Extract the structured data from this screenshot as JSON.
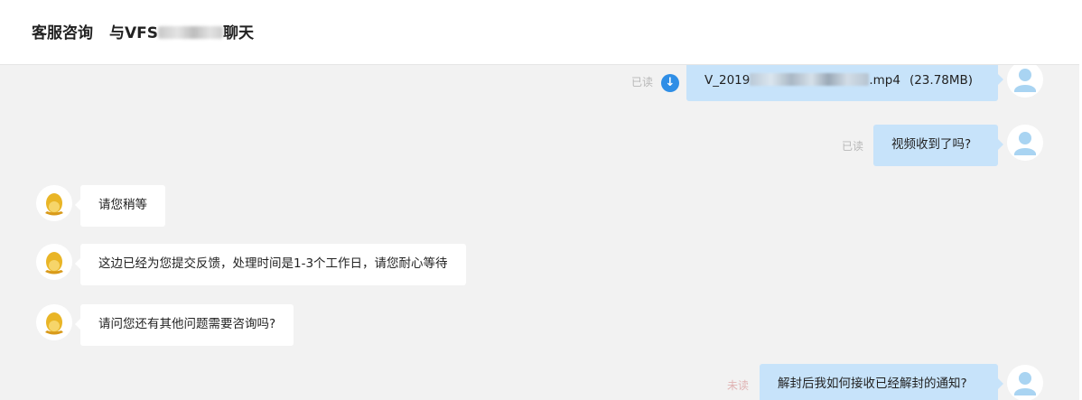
{
  "header": {
    "title_main": "客服咨询",
    "title_prefix": "与VFS",
    "title_suffix": "聊天"
  },
  "icons": {
    "agent_avatar": "penguin-avatar-icon",
    "user_avatar": "default-user-avatar-icon",
    "download": "download-arrow-icon"
  },
  "colors": {
    "user_bubble": "#c7e3fa",
    "agent_bubble": "#ffffff",
    "download_icon": "#2f8ee6",
    "status_read": "#b8b8b8",
    "status_unread": "#e0b4b4"
  },
  "messages": [
    {
      "side": "right",
      "status": "已读",
      "type": "file",
      "file_prefix": "V_2019",
      "file_ext": ".mp4",
      "file_size": "(23.78MB)"
    },
    {
      "side": "right",
      "status": "已读",
      "text": "视频收到了吗?"
    },
    {
      "side": "left",
      "text": "请您稍等"
    },
    {
      "side": "left",
      "text": "这边已经为您提交反馈，处理时间是1-3个工作日，请您耐心等待"
    },
    {
      "side": "left",
      "text": "请问您还有其他问题需要咨询吗?"
    },
    {
      "side": "right",
      "status": "未读",
      "text": "解封后我如何接收已经解封的通知?"
    }
  ]
}
